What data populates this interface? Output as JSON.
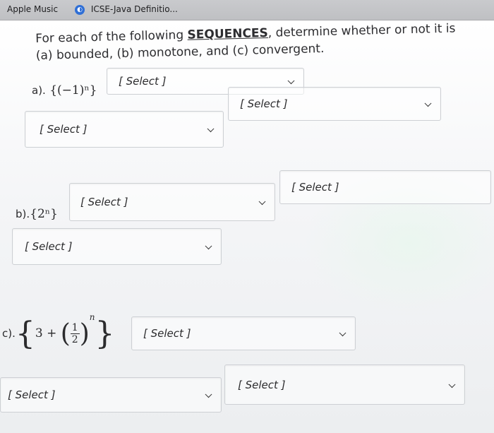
{
  "browser": {
    "bookmarks": [
      {
        "label": "Apple Music",
        "icon": "apple-music-icon"
      },
      {
        "label": "ICSE-Java Definitio...",
        "icon": "globe-icon"
      }
    ]
  },
  "question": {
    "intro_prefix": "For each of the following ",
    "intro_emphasis": "SEQUENCES",
    "intro_suffix": ", determine whether or not it is",
    "intro_line2": "(a) bounded, (b) monotone, and (c) convergent."
  },
  "parts": [
    {
      "id": "a",
      "label": "a).",
      "sequence": "{(−1)ⁿ}",
      "dropdowns": [
        "[ Select ]",
        "[ Select ]",
        "[ Select ]"
      ]
    },
    {
      "id": "b",
      "label": "b).",
      "sequence": "{2ⁿ}",
      "dropdowns": [
        "[ Select ]",
        "[ Select ]",
        "[ Select ]"
      ]
    },
    {
      "id": "c",
      "label": "c).",
      "sequence_lead": "3 +",
      "frac_num": "1",
      "frac_den": "2",
      "exp": "n",
      "dropdowns": [
        "[ Select ]",
        "[ Select ]",
        "[ Select ]"
      ]
    }
  ]
}
